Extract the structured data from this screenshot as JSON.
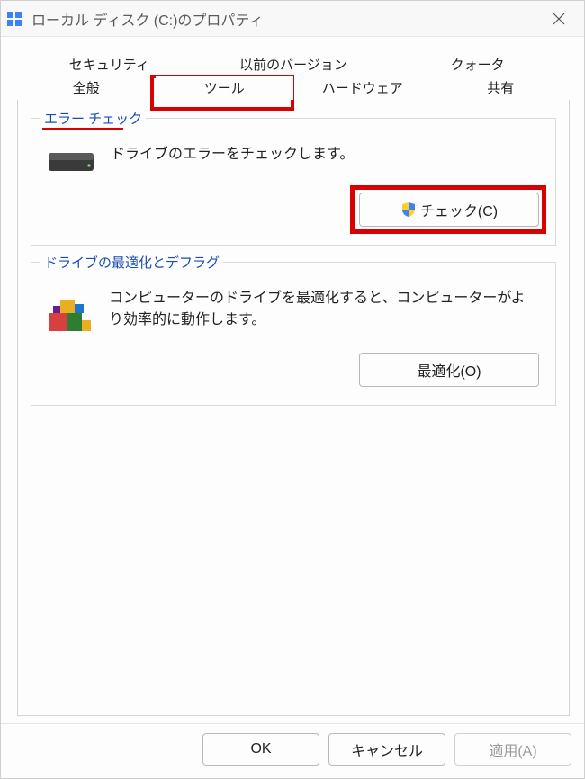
{
  "window": {
    "title": "ローカル ディスク (C:)のプロパティ"
  },
  "tabs": {
    "row1": [
      "セキュリティ",
      "以前のバージョン",
      "クォータ"
    ],
    "row2": [
      "全般",
      "ツール",
      "ハードウェア",
      "共有"
    ],
    "active": "ツール"
  },
  "errorCheck": {
    "legend": "エラー チェック",
    "description": "ドライブのエラーをチェックします。",
    "buttonLabel": "チェック(C)"
  },
  "defrag": {
    "legend": "ドライブの最適化とデフラグ",
    "description": "コンピューターのドライブを最適化すると、コンピューターがより効率的に動作します。",
    "buttonLabel": "最適化(O)"
  },
  "dialogButtons": {
    "ok": "OK",
    "cancel": "キャンセル",
    "apply": "適用(A)"
  },
  "icons": {
    "shield": "shield-icon",
    "drive": "drive-icon",
    "defrag": "defrag-blocks-icon"
  }
}
